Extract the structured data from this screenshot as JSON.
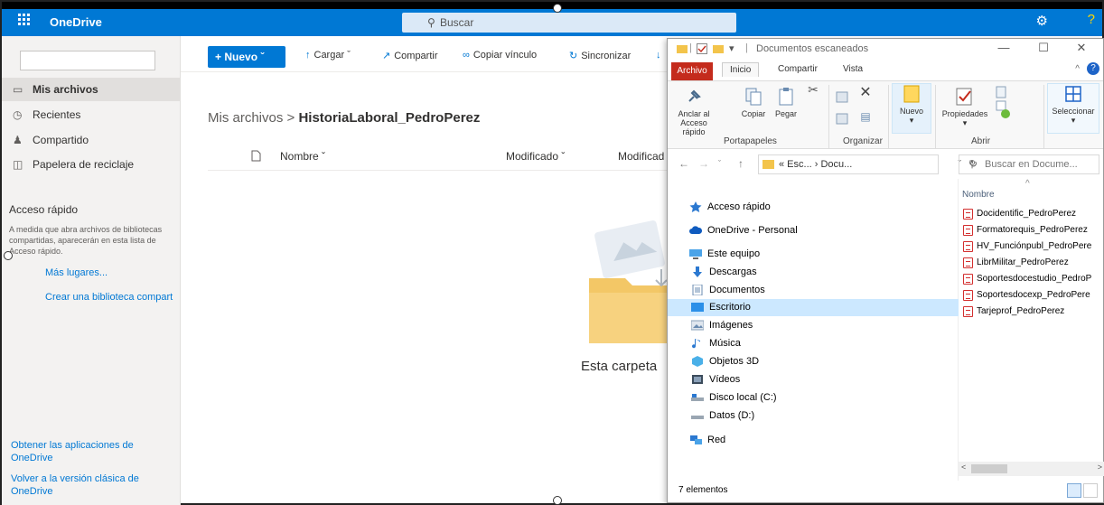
{
  "onedrive": {
    "brand": "OneDrive",
    "search_placeholder": "Buscar",
    "nav": {
      "items": [
        {
          "label": "Mis archivos"
        },
        {
          "label": "Recientes"
        },
        {
          "label": "Compartido"
        },
        {
          "label": "Papelera de reciclaje"
        }
      ],
      "quick_access_title": "Acceso rápido",
      "quick_access_text": "A medida que abra archivos de bibliotecas compartidas, aparecerán en esta lista de Acceso rápido.",
      "more_places": "Más lugares...",
      "create_library": "Crear una biblioteca compart",
      "get_apps": "Obtener las aplicaciones de OneDrive",
      "classic": "Volver a la versión clásica de OneDrive"
    },
    "commands": {
      "new": "Nuevo",
      "upload": "Cargar",
      "share": "Compartir",
      "copy_link": "Copiar vínculo",
      "sync": "Sincronizar"
    },
    "breadcrumb": {
      "root": "Mis archivos",
      "current": "HistoriaLaboral_PedroPerez"
    },
    "columns": {
      "name": "Nombre",
      "modified": "Modificado",
      "modified_by": "Modificad"
    },
    "empty_text": "Esta carpeta"
  },
  "explorer": {
    "title": "Documentos escaneados",
    "tabs": {
      "file": "Archivo",
      "home": "Inicio",
      "share": "Compartir",
      "view": "Vista"
    },
    "ribbon": {
      "pin": "Anclar al Acceso rápido",
      "copy": "Copiar",
      "paste": "Pegar",
      "group_clipboard": "Portapapeles",
      "group_organize": "Organizar",
      "new": "Nuevo",
      "properties": "Propiedades",
      "group_open": "Abrir",
      "select": "Seleccionar"
    },
    "address": "« Esc... › Docu...",
    "search_placeholder": "Buscar en Docume...",
    "tree": [
      {
        "label": "Acceso rápido",
        "icon": "star-icon"
      },
      {
        "label": "OneDrive - Personal",
        "icon": "cloud-icon"
      },
      {
        "label": "Este equipo",
        "icon": "computer-icon"
      },
      {
        "label": "Descargas",
        "icon": "download-icon"
      },
      {
        "label": "Documentos",
        "icon": "documents-icon"
      },
      {
        "label": "Escritorio",
        "icon": "desktop-icon"
      },
      {
        "label": "Imágenes",
        "icon": "pictures-icon"
      },
      {
        "label": "Música",
        "icon": "music-icon"
      },
      {
        "label": "Objetos 3D",
        "icon": "3d-objects-icon"
      },
      {
        "label": "Vídeos",
        "icon": "videos-icon"
      },
      {
        "label": "Disco local (C:)",
        "icon": "drive-icon"
      },
      {
        "label": "Datos (D:)",
        "icon": "drive-icon"
      },
      {
        "label": "Red",
        "icon": "network-icon"
      }
    ],
    "list_header": "Nombre",
    "files": [
      "Docidentific_PedroPerez",
      "Formatorequis_PedroPerez",
      "HV_Funciónpubl_PedroPere",
      "LibrMilitar_PedroPerez",
      "Soportesdocestudio_PedroP",
      "Soportesdocexp_PedroPere",
      "Tarjeprof_PedroPerez"
    ],
    "status": "7 elementos"
  },
  "colors": {
    "accent": "#0078d4",
    "archivo_tab": "#c42b1c",
    "selection": "#cce8ff"
  }
}
